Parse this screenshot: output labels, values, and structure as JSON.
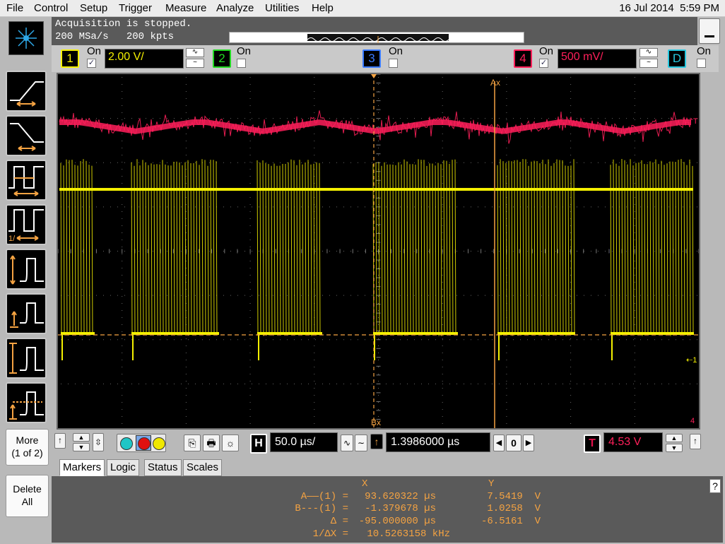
{
  "menu": [
    "File",
    "Control",
    "Setup",
    "Trigger",
    "Measure",
    "Analyze",
    "Utilities",
    "Help"
  ],
  "datetime": {
    "date": "16 Jul 2014",
    "time": "5:59 PM"
  },
  "acquisition": {
    "status": "Acquisition is stopped.",
    "rate": "200 MSa/s",
    "points": "200 kpts"
  },
  "channels": [
    {
      "num": "1",
      "on_label": "On",
      "checked": true,
      "scale": "2.00 V/",
      "color": "#f4f000"
    },
    {
      "num": "2",
      "on_label": "On",
      "checked": false,
      "color": "#22d922"
    },
    {
      "num": "3",
      "on_label": "On",
      "checked": false,
      "color": "#3a7bff"
    },
    {
      "num": "4",
      "on_label": "On",
      "checked": true,
      "scale": "500 mV/",
      "color": "#ff1f5a"
    },
    {
      "num": "D",
      "on_label": "On",
      "checked": false,
      "color": "#27c8e0"
    }
  ],
  "left_buttons": {
    "more": "More",
    "more_sub": "(1 of 2)",
    "delete": "Delete",
    "delete_sub": "All"
  },
  "cursors": {
    "ax": "Ax",
    "bx": "Bx",
    "trig_mark": "T",
    "ch1_mark": "1",
    "ch4_mark": "4"
  },
  "horizontal": {
    "label": "H",
    "scale": "50.0 µs/",
    "delay": "1.3986000 µs",
    "ref": "0"
  },
  "trigger": {
    "label": "T",
    "level": "4.53 V"
  },
  "tabs": [
    "Markers",
    "Logic",
    "Status",
    "Scales"
  ],
  "active_tab": "Markers",
  "markers": {
    "header_x": "X",
    "header_y": "Y",
    "rows": [
      {
        "label": "A——(1) =",
        "x": "93.620322 µs",
        "y": "7.5419  V"
      },
      {
        "label": "B---(1) =",
        "x": "-1.379678 µs",
        "y": "1.0258  V"
      },
      {
        "label": "Δ =",
        "x": "-95.000000 µs",
        "y": "-6.5161  V"
      },
      {
        "label": "1/ΔX =",
        "x": "10.5263158 kHz",
        "y": ""
      }
    ]
  },
  "help": "?"
}
